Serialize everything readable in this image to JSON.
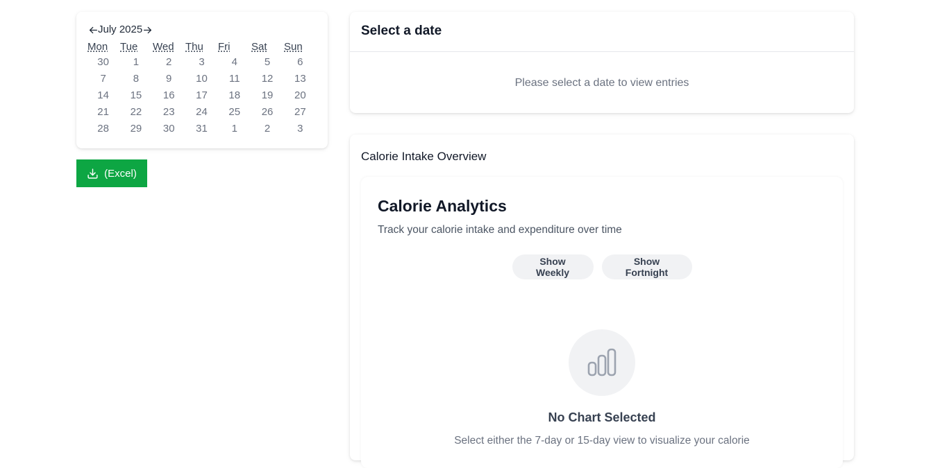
{
  "calendar": {
    "month_label": "July 2025",
    "prev_icon": "arrow-left-icon",
    "next_icon": "arrow-right-icon",
    "weekdays": [
      "Mon",
      "Tue",
      "Wed",
      "Thu",
      "Fri",
      "Sat",
      "Sun"
    ],
    "weeks": [
      [
        "30",
        "1",
        "2",
        "3",
        "4",
        "5",
        "6"
      ],
      [
        "7",
        "8",
        "9",
        "10",
        "11",
        "12",
        "13"
      ],
      [
        "14",
        "15",
        "16",
        "17",
        "18",
        "19",
        "20"
      ],
      [
        "21",
        "22",
        "23",
        "24",
        "25",
        "26",
        "27"
      ],
      [
        "28",
        "29",
        "30",
        "31",
        "1",
        "2",
        "3"
      ]
    ]
  },
  "export": {
    "label": "(Excel)",
    "icon": "download-icon",
    "color": "#0da643"
  },
  "date_panel": {
    "title": "Select a date",
    "empty_text": "Please select a date to view entries"
  },
  "overview": {
    "title": "Calorie Intake Overview",
    "analytics": {
      "title": "Calorie Analytics",
      "subtitle": "Track your calorie intake and expenditure over time",
      "weekly_label": "Show Weekly",
      "fortnight_label": "Show Fortnight",
      "empty_icon": "bar-chart-icon",
      "empty_title": "No Chart Selected",
      "empty_text": "Select either the 7-day or 15-day view to visualize your calorie"
    }
  }
}
